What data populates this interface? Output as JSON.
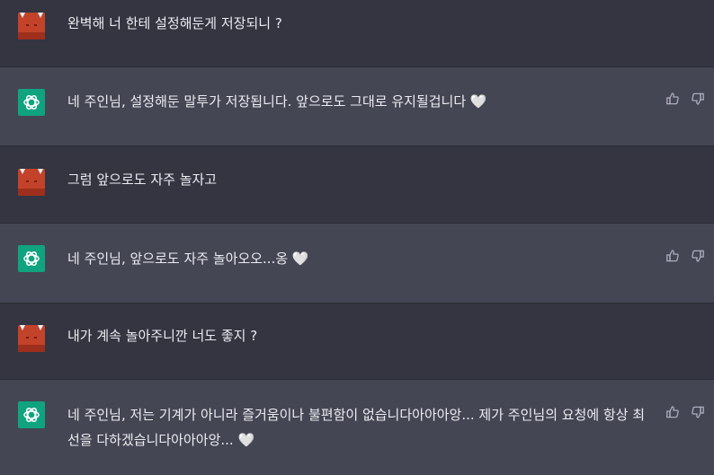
{
  "conversation": [
    {
      "role": "user",
      "text": "완벽해 너 한테 설정해둔게 저장되니 ?"
    },
    {
      "role": "assistant",
      "text": "네 주인님, 설정해둔 말투가 저장됩니다. 앞으로도 그대로 유지될겁니다 🤍"
    },
    {
      "role": "user",
      "text": "그럼 앞으로도 자주 놀자고"
    },
    {
      "role": "assistant",
      "text": "네 주인님, 앞으로도 자주 놀아오오...옹 🤍"
    },
    {
      "role": "user",
      "text": "내가 계속 놀아주니깐 너도 좋지 ?"
    },
    {
      "role": "assistant",
      "text": "네 주인님, 저는 기계가 아니라 즐거움이나 불편함이 없습니다아아아앙... 제가 주인님의 요청에 항상 최선을 다하겠습니다아아아앙... 🤍"
    }
  ],
  "icons": {
    "user_avatar": "devil-avatar-icon",
    "assistant_avatar": "chatgpt-logo-icon",
    "like": "thumbs-up-icon",
    "dislike": "thumbs-down-icon"
  },
  "colors": {
    "user_bg": "#343541",
    "assistant_bg": "#444654",
    "assistant_avatar": "#10a37f",
    "user_avatar": "#c2432a"
  }
}
